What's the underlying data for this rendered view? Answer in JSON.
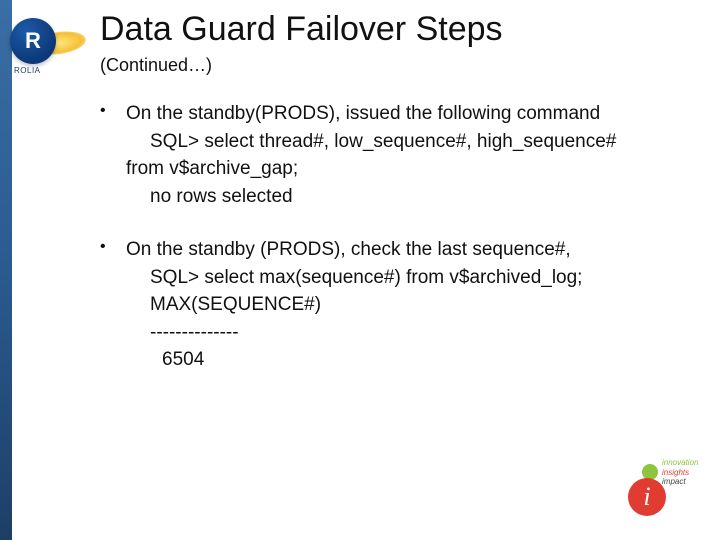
{
  "logo": {
    "initial": "R",
    "label": "ROLIA"
  },
  "title": "Data Guard Failover Steps",
  "subtitle": "(Continued…)",
  "bullets": [
    {
      "lead": "On the standby(PRODS), issued the following command",
      "lines": [
        {
          "text": "SQL> select thread#, low_sequence#, high_sequence# from v$archive_gap;",
          "cls": "indent1 wrap"
        },
        {
          "text": "no rows selected",
          "cls": "indent1"
        }
      ]
    },
    {
      "lead": "On the standby (PRODS), check the last sequence#,",
      "lines": [
        {
          "text": "SQL> select max(sequence#) from v$archived_log;",
          "cls": "indent1"
        },
        {
          "text": "MAX(SEQUENCE#)",
          "cls": "indent1"
        },
        {
          "text": "--------------",
          "cls": "indent1"
        },
        {
          "text": "6504",
          "cls": "indent2"
        }
      ]
    }
  ],
  "footer_logo": {
    "glyph": "i",
    "w1": "innovation",
    "w2": "insights",
    "w3": "impact"
  }
}
